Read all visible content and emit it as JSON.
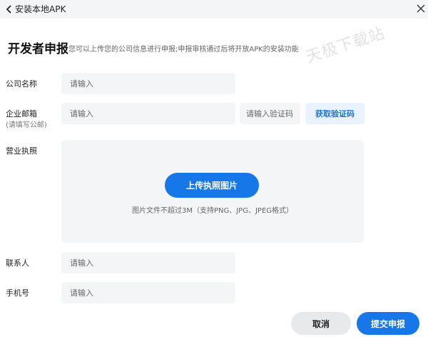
{
  "window": {
    "title": "安装本地APK",
    "back_icon": "chevron-left-icon",
    "close_icon": "close-icon"
  },
  "section": {
    "title": "开发者申报",
    "description": "您可以上传您的公司信息进行申报;申报审核通过后将开放APK的安装功能",
    "watermark": "天极下载站"
  },
  "form": {
    "company": {
      "label": "公司名称",
      "placeholder": "请输入",
      "value": ""
    },
    "email": {
      "label": "企业邮箱",
      "sublabel": "(请填写公邮)",
      "placeholder": "请输入",
      "value": ""
    },
    "code": {
      "placeholder": "请输入验证码",
      "value": "",
      "button_label": "获取验证码"
    },
    "license": {
      "label": "营业执照",
      "upload_button": "上传执照图片",
      "hint": "图片文件不超过3M（支持PNG、JPG、JPEG格式）"
    },
    "contact": {
      "label": "联系人",
      "placeholder": "请输入",
      "value": ""
    },
    "phone": {
      "label": "手机号",
      "placeholder": "请输入",
      "value": ""
    }
  },
  "actions": {
    "cancel_label": "取消",
    "submit_label": "提交申报"
  },
  "colors": {
    "accent": "#1677e8",
    "input_bg": "#f4f5f7",
    "code_button_bg": "#e9f3ff"
  }
}
